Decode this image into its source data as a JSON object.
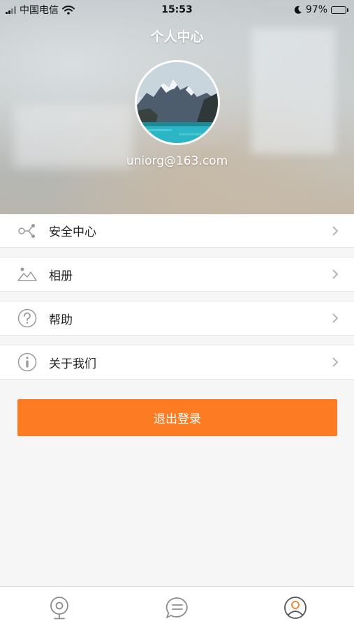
{
  "status_bar": {
    "carrier": "中国电信",
    "time": "15:53",
    "battery": "97%",
    "icons": [
      "signal-icon",
      "wifi-icon",
      "moon-icon",
      "battery-charging-icon"
    ]
  },
  "header": {
    "title": "个人中心",
    "email": "uniorg@163.com",
    "avatar_icon": "mountain-lake-avatar"
  },
  "menu": {
    "items": [
      {
        "label": "安全中心",
        "icon": "share-nodes-icon"
      },
      {
        "label": "相册",
        "icon": "landscape-picture-icon"
      },
      {
        "label": "帮助",
        "icon": "help-circle-icon"
      },
      {
        "label": "关于我们",
        "icon": "info-circle-icon"
      }
    ]
  },
  "logout": {
    "label": "退出登录"
  },
  "colors": {
    "accent": "#fd7b23",
    "background": "#f6f6f6",
    "icon_gray": "#9a9a9a"
  },
  "tabbar": {
    "tabs": [
      {
        "icon": "camera-icon",
        "active": false
      },
      {
        "icon": "message-icon",
        "active": false
      },
      {
        "icon": "user-icon",
        "active": true
      }
    ]
  }
}
